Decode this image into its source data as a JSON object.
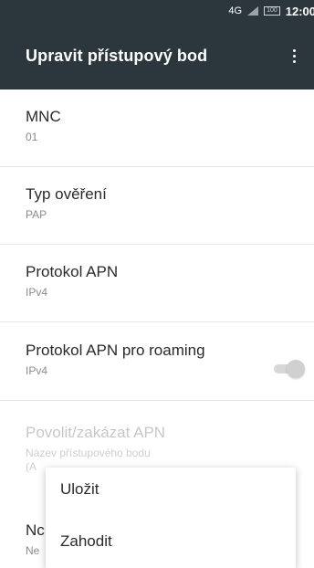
{
  "status_bar": {
    "network": "4G",
    "battery": "100",
    "time": "12:00"
  },
  "app_bar": {
    "title": "Upravit přístupový bod",
    "more_icon": "more-vert-icon"
  },
  "settings": [
    {
      "title": "MNC",
      "value": "01"
    },
    {
      "title": "Typ ověření",
      "value": "PAP"
    },
    {
      "title": "Protokol APN",
      "value": "IPv4"
    },
    {
      "title": "Protokol APN pro roaming",
      "value": "IPv4"
    },
    {
      "title": "Povolit/zakázat APN",
      "value": "Název přístupového bodu",
      "value2": "(A",
      "enabled": false
    }
  ],
  "partial_row": {
    "title": "Nc",
    "value": "Ne"
  },
  "menu": {
    "items": [
      "Uložit",
      "Zahodit"
    ]
  },
  "colors": {
    "app_bar": "#2c363d",
    "text_primary": "#2a2a2a",
    "text_secondary": "#8a8a8a",
    "disabled": "#c7c7c7"
  }
}
